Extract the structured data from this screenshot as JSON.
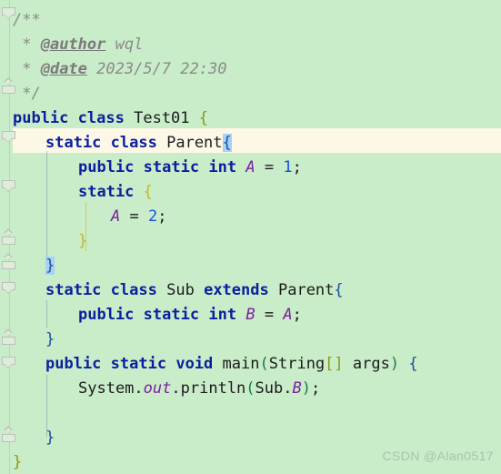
{
  "editor": {
    "language": "java",
    "background_color": "#c9ecc9",
    "caret_line_color": "#fdf8e6",
    "selection_color": "#a6d2f5",
    "watermark": "CSDN @Alan0517"
  },
  "code_lines": [
    {
      "n": 1,
      "indent": 0,
      "text": "/**"
    },
    {
      "n": 2,
      "indent": 0,
      "text": " * @author wql"
    },
    {
      "n": 3,
      "indent": 0,
      "text": " * @date 2023/5/7 22:30"
    },
    {
      "n": 4,
      "indent": 0,
      "text": " */"
    },
    {
      "n": 5,
      "indent": 0,
      "text": "public class Test01 {"
    },
    {
      "n": 6,
      "indent": 1,
      "text": "static class Parent{",
      "caret": true
    },
    {
      "n": 7,
      "indent": 2,
      "text": "public static int A = 1;"
    },
    {
      "n": 8,
      "indent": 2,
      "text": "static {"
    },
    {
      "n": 9,
      "indent": 3,
      "text": "A = 2;"
    },
    {
      "n": 10,
      "indent": 2,
      "text": "}"
    },
    {
      "n": 11,
      "indent": 1,
      "text": "}"
    },
    {
      "n": 12,
      "indent": 1,
      "text": "static class Sub extends Parent{"
    },
    {
      "n": 13,
      "indent": 2,
      "text": "public static int B = A;"
    },
    {
      "n": 14,
      "indent": 1,
      "text": "}"
    },
    {
      "n": 15,
      "indent": 1,
      "text": "public static void main(String[] args) {"
    },
    {
      "n": 16,
      "indent": 2,
      "text": "System.out.println(Sub.B);"
    },
    {
      "n": 17,
      "indent": 0,
      "text": ""
    },
    {
      "n": 18,
      "indent": 1,
      "text": "}"
    },
    {
      "n": 19,
      "indent": 0,
      "text": "}"
    }
  ],
  "tokens": {
    "comment_open": "/**",
    "comment_star": " * ",
    "tag_author": "@author",
    "author_value": " wql",
    "tag_date": "@date",
    "date_value": " 2023/5/7 22:30",
    "comment_close": " */",
    "kw_public": "public",
    "kw_class": "class",
    "kw_static": "static",
    "kw_int": "int",
    "kw_void": "void",
    "kw_extends": "extends",
    "type_Test01": "Test01",
    "type_Parent": "Parent",
    "type_Sub": "Sub",
    "type_String": "String",
    "field_A": "A",
    "field_B": "B",
    "ident_System": "System",
    "ident_out": "out",
    "method_println": "println",
    "method_main": "main",
    "param_args": "args",
    "num_1": "1",
    "num_2": "2",
    "brace_open": "{",
    "brace_close": "}",
    "paren_open": "(",
    "paren_close": ")",
    "bracket_pair": "[]",
    "semicolon": ";",
    "equals": "=",
    "dot": ".",
    "space": " "
  },
  "gutter": {
    "fold_markers": [
      {
        "line": 1,
        "dir": "down"
      },
      {
        "line": 4,
        "dir": "up"
      },
      {
        "line": 5,
        "dir": "down"
      },
      {
        "line": 6,
        "dir": "down"
      },
      {
        "line": 8,
        "dir": "down"
      },
      {
        "line": 10,
        "dir": "up"
      },
      {
        "line": 11,
        "dir": "up"
      },
      {
        "line": 12,
        "dir": "down"
      },
      {
        "line": 14,
        "dir": "up"
      },
      {
        "line": 15,
        "dir": "down"
      },
      {
        "line": 18,
        "dir": "up"
      }
    ]
  }
}
